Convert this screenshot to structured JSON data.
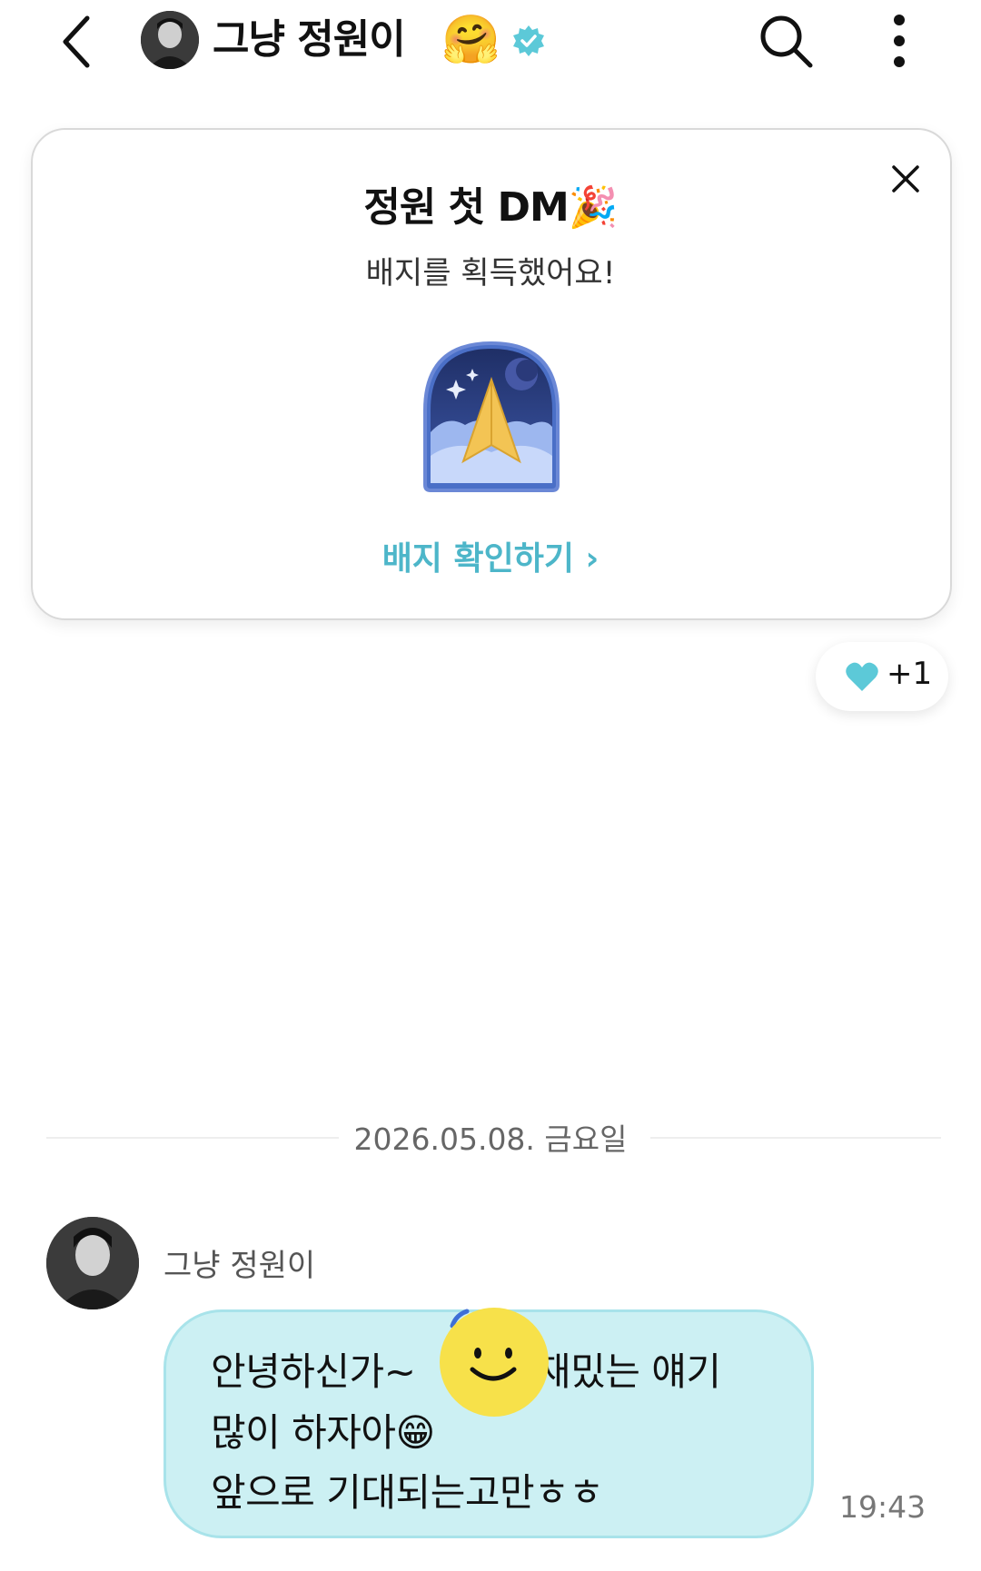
{
  "header": {
    "title": "그냥 정원이",
    "title_emoji": "🤗"
  },
  "badge_card": {
    "title": "정원 첫 DM🎉",
    "subtitle": "배지를 획득했어요!",
    "link_label": "배지 확인하기 ›"
  },
  "reaction": {
    "count": "+1",
    "color": "#5cc9d8"
  },
  "divider": {
    "date": "2026.05.08. 금요일"
  },
  "message": {
    "sender": "그냥 정원이",
    "lines": [
      "안녕하신가~ ",
      "많이 하자아😁",
      "앞으로 기대되는고만ㅎㅎ"
    ],
    "line1_tail": "재밌는 얘기",
    "time": "19:43"
  },
  "colors": {
    "accent": "#4db6c9",
    "bubble_bg": "#ccf0f3",
    "verified": "#5cc9d8"
  }
}
